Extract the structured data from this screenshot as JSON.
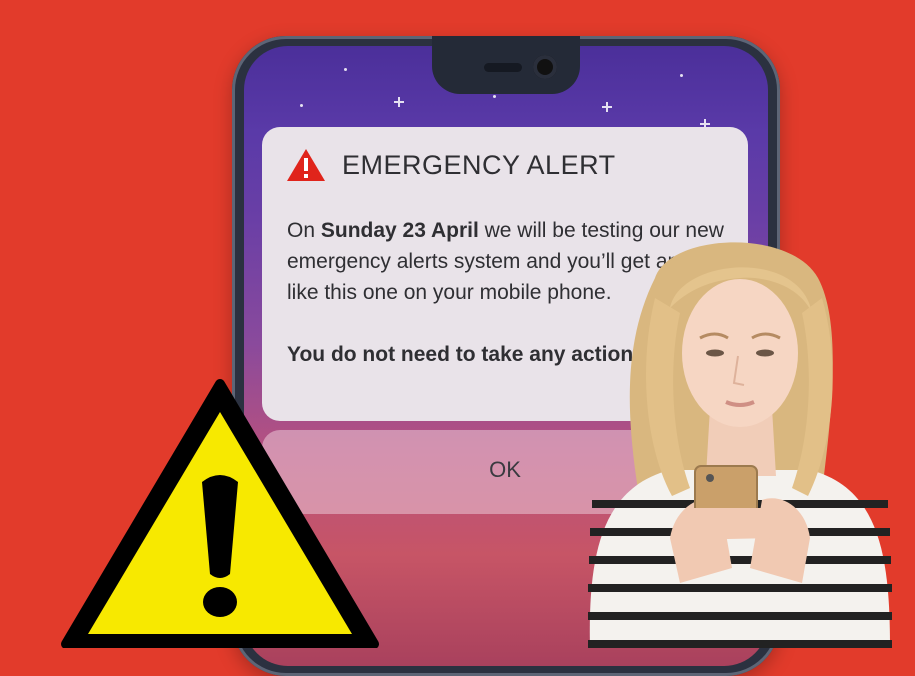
{
  "alert": {
    "title": "EMERGENCY ALERT",
    "body_pre": "On ",
    "body_date": "Sunday 23 April",
    "body_post": " we will be testing our new emergency alerts system and you’ll get an alert like this one on your mobile phone.",
    "body_action": "You do not need to take any action."
  },
  "dialog": {
    "ok_label": "OK"
  },
  "icons": {
    "alert_icon": "warning-triangle-red",
    "warning_sign": "warning-triangle-yellow"
  },
  "colors": {
    "background": "#e23b2b",
    "alert_card": "#e9e3e9",
    "alert_icon": "#e0241b",
    "warning_yellow": "#f7e900"
  }
}
